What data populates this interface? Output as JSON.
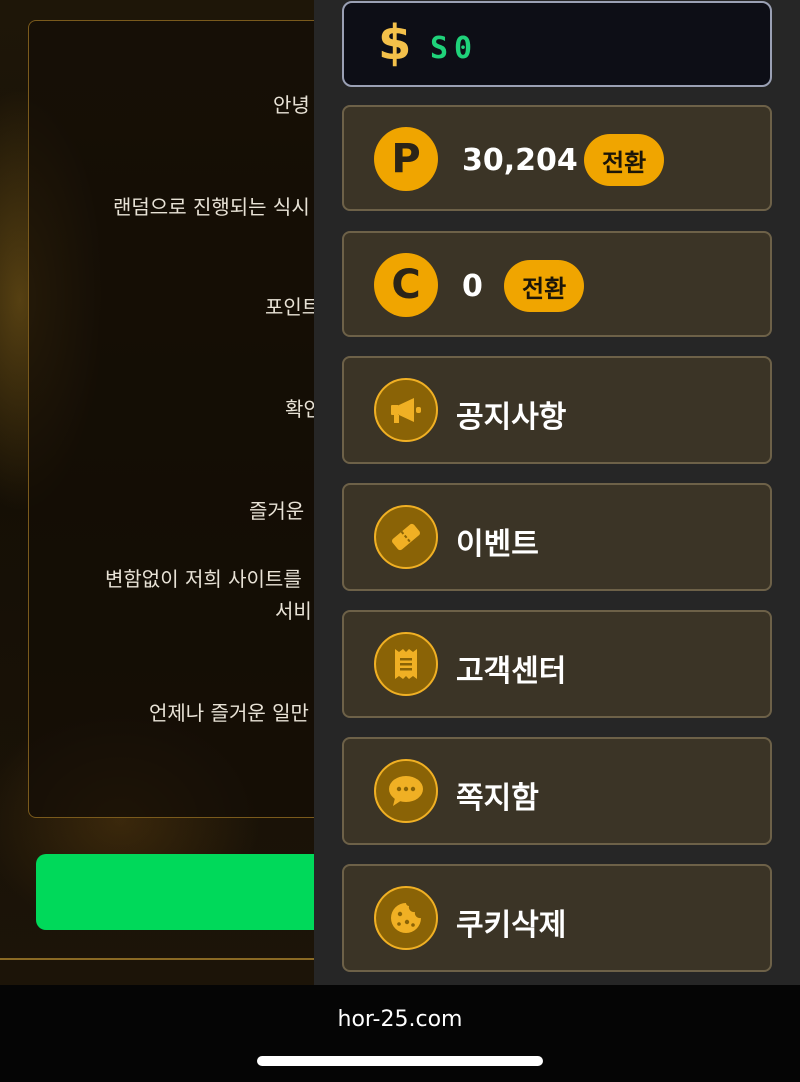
{
  "notice": {
    "lines": [
      "안녕",
      "랜덤으로 진행되는 식시",
      "포인트",
      "확인",
      "즐거운",
      "변함없이 저희 사이트를",
      "서비",
      "언제나 즐거운 일만"
    ]
  },
  "wallet": {
    "currency_symbol": "$",
    "balance": "S0"
  },
  "points": {
    "icon_letter": "P",
    "amount": "30,204",
    "convert_label": "전환"
  },
  "coins": {
    "icon_letter": "C",
    "amount": "0",
    "convert_label": "전환"
  },
  "menu": {
    "notice": "공지사항",
    "event": "이벤트",
    "support": "고객센터",
    "messages": "쪽지함",
    "clear_cookies": "쿠키삭제"
  },
  "browser": {
    "url": "hor-25.com"
  },
  "colors": {
    "accent_gold": "#f0a500",
    "balance_green": "#1fd27a",
    "confirm_green": "#00d95a"
  }
}
